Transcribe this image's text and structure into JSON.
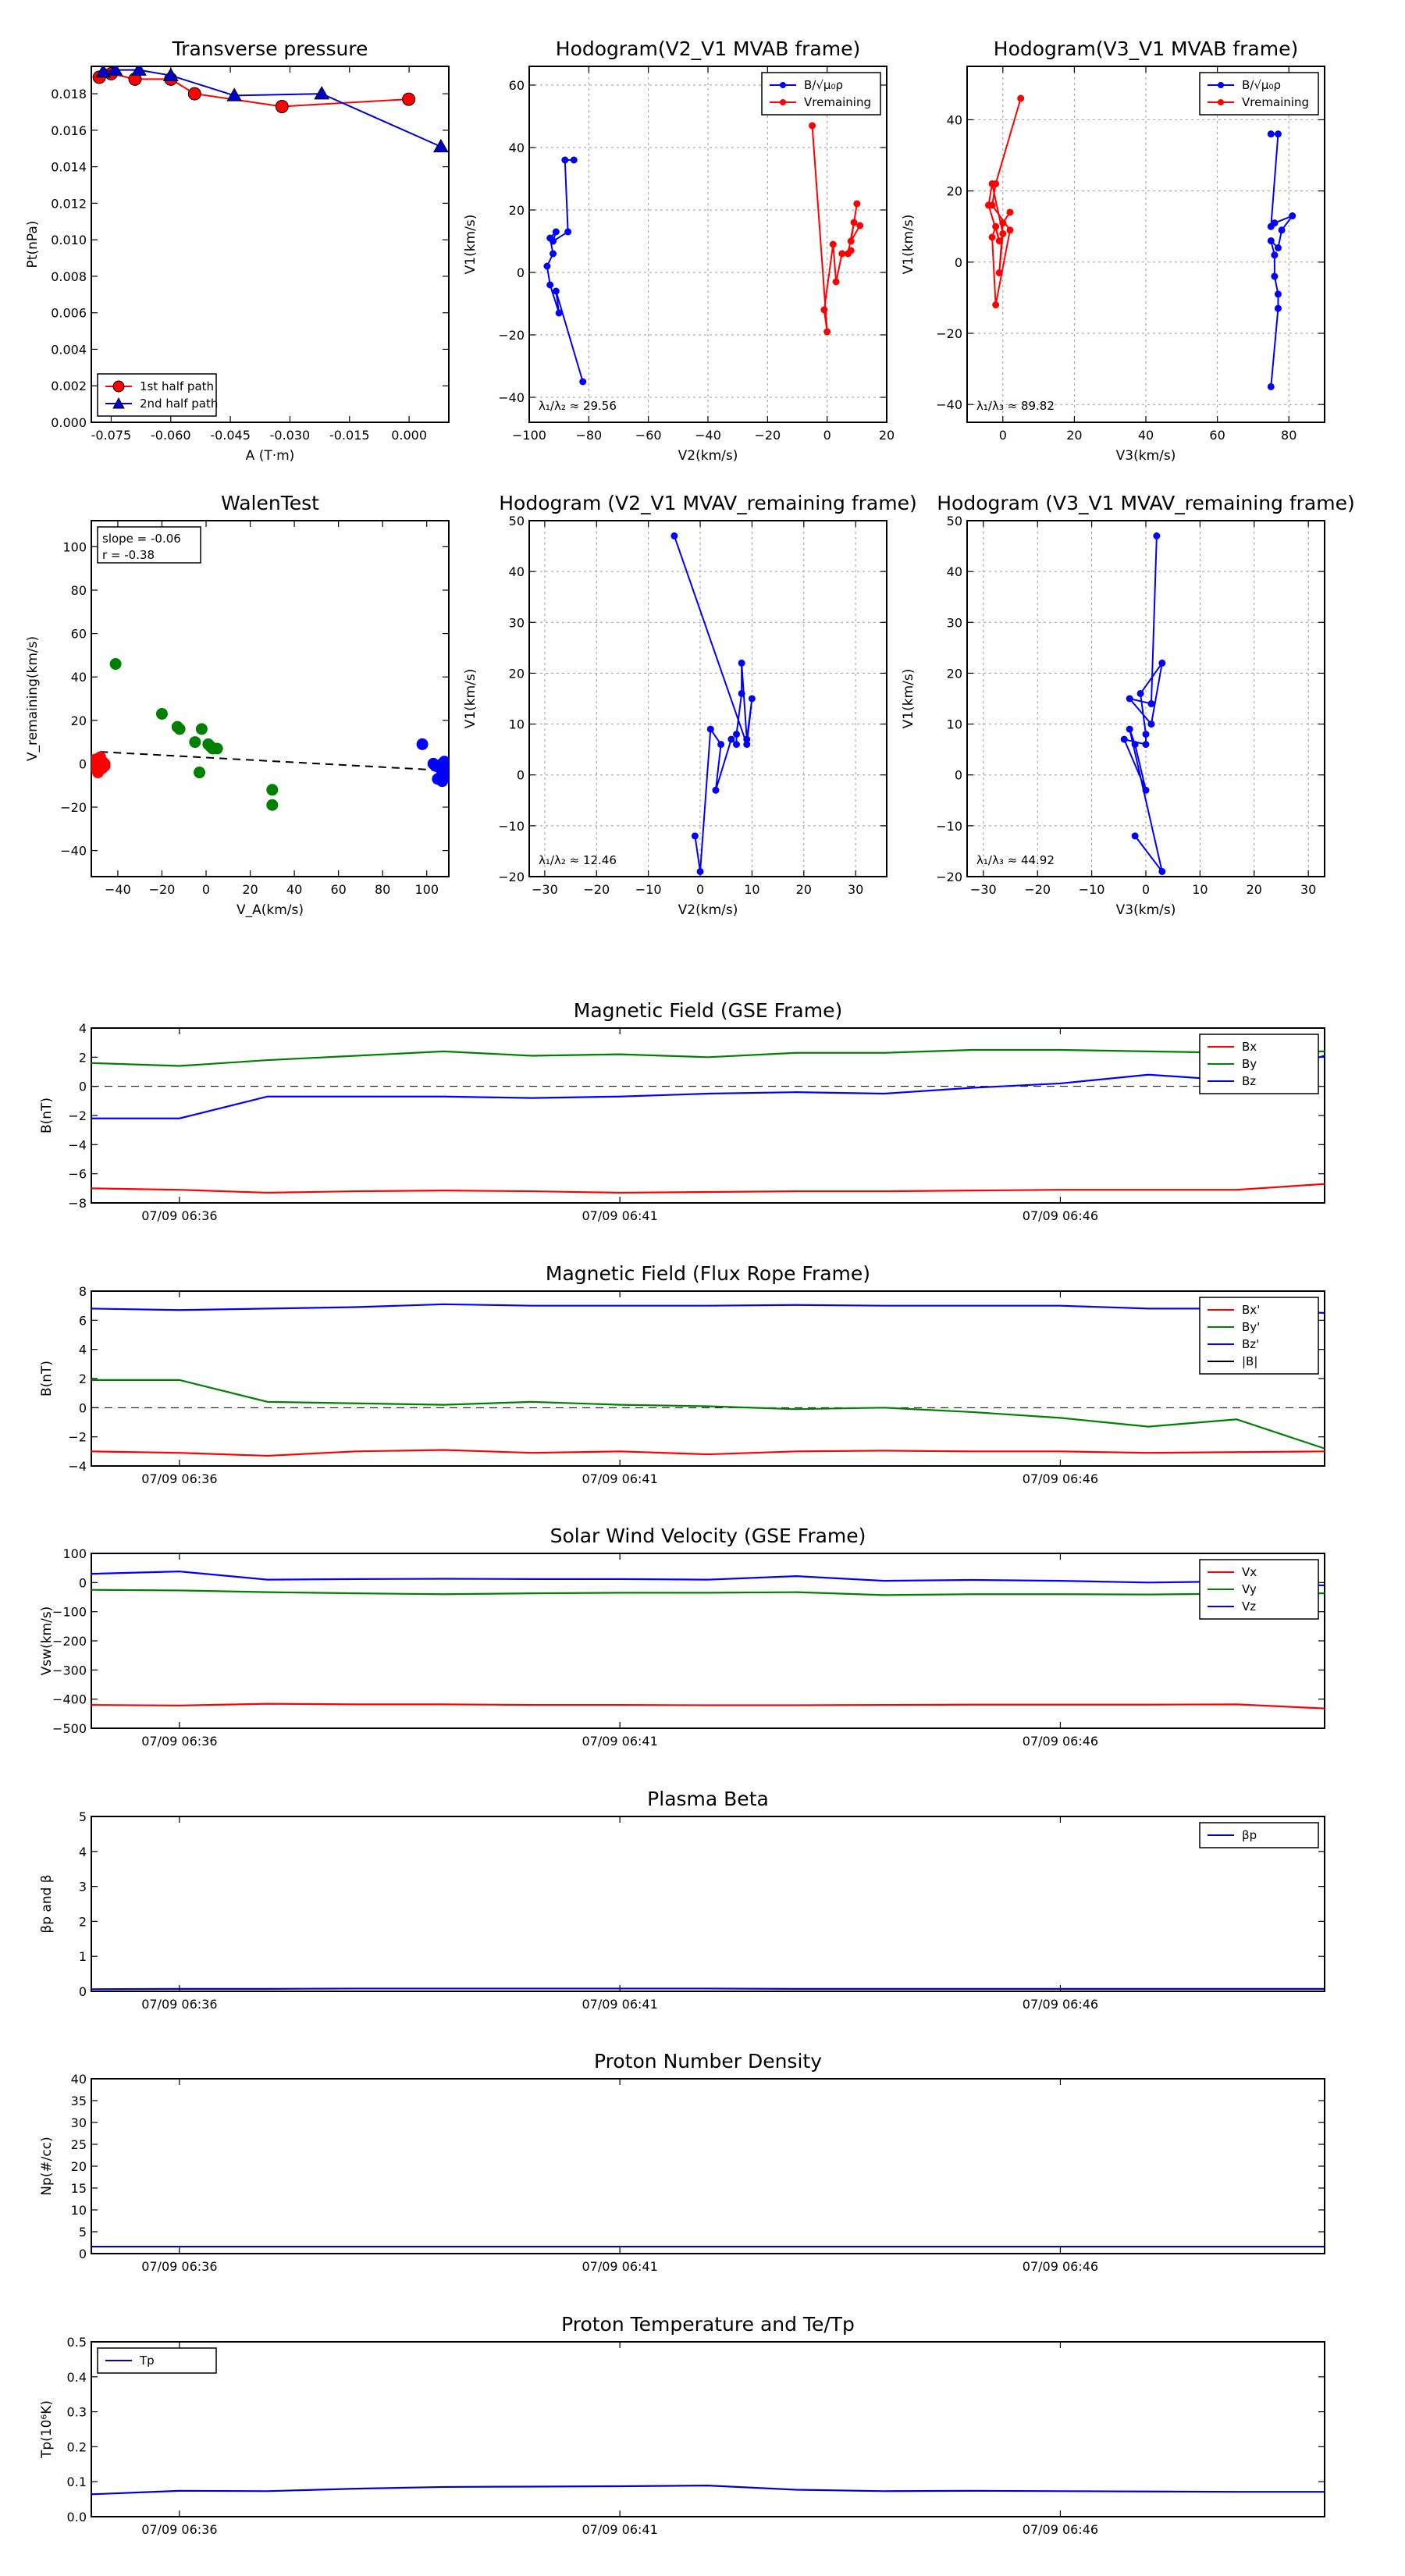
{
  "figure": {
    "background": "#ffffff"
  },
  "chart_data": [
    {
      "id": "tp",
      "type": "line",
      "title": "Transverse pressure",
      "xlabel": "A (T·m)",
      "ylabel": "Pt(nPa)",
      "xlim": [
        -0.08,
        0.01
      ],
      "ylim": [
        0.0,
        0.0195
      ],
      "xticks": [
        -0.075,
        -0.06,
        -0.045,
        -0.03,
        -0.015,
        0.0
      ],
      "xtick_labels": [
        "-0.075",
        "-0.060",
        "-0.045",
        "-0.030",
        "-0.015",
        "0.000"
      ],
      "yticks": [
        0.0,
        0.002,
        0.004,
        0.006,
        0.008,
        0.01,
        0.012,
        0.014,
        0.016,
        0.018
      ],
      "ytick_labels": [
        "0.000",
        "0.002",
        "0.004",
        "0.006",
        "0.008",
        "0.010",
        "0.012",
        "0.014",
        "0.016",
        "0.018"
      ],
      "grid": false,
      "legend": "lower-left",
      "series": [
        {
          "name": "1st half path",
          "color": "#ff0000",
          "marker": "circle",
          "x": [
            -0.0001,
            -0.032,
            -0.054,
            -0.06,
            -0.069,
            -0.075,
            -0.078
          ],
          "y": [
            0.0177,
            0.0173,
            0.018,
            0.0188,
            0.0188,
            0.0191,
            0.0189
          ]
        },
        {
          "name": "2nd half path",
          "color": "#0000cc",
          "marker": "triangle",
          "x": [
            -0.077,
            -0.074,
            -0.068,
            -0.06,
            -0.044,
            -0.022,
            0.008
          ],
          "y": [
            0.0192,
            0.0193,
            0.0193,
            0.019,
            0.0179,
            0.018,
            0.0151
          ]
        }
      ]
    },
    {
      "id": "h1",
      "type": "line",
      "title": "Hodogram(V2_V1 MVAB frame)",
      "xlabel": "V2(km/s)",
      "ylabel": "V1(km/s)",
      "xlim": [
        -100,
        20
      ],
      "ylim": [
        -48,
        66
      ],
      "xticks": [
        -100,
        -80,
        -60,
        -40,
        -20,
        0,
        20
      ],
      "yticks": [
        -40,
        -20,
        0,
        20,
        40,
        60
      ],
      "grid": true,
      "legend": "top-right",
      "annotation": "λ₁/λ₂ ≈ 29.56",
      "series": [
        {
          "name": "B/√μ₀ρ",
          "color": "#0000ff",
          "marker": "dot",
          "x": [
            -82,
            -91,
            -90,
            -93,
            -94,
            -92,
            -93,
            -91,
            -92,
            -87,
            -88,
            -85
          ],
          "y": [
            -35,
            -6,
            -13,
            -4,
            2,
            6,
            11,
            13,
            10,
            13,
            36,
            36
          ]
        },
        {
          "name": "Vremaining",
          "color": "#ff0000",
          "marker": "dot",
          "x": [
            -5,
            0,
            -1,
            2,
            3,
            5,
            8,
            7,
            9,
            10,
            8,
            11
          ],
          "y": [
            47,
            -19,
            -12,
            9,
            -3,
            6,
            7,
            6,
            16,
            22,
            10,
            15
          ]
        }
      ]
    },
    {
      "id": "h2",
      "type": "line",
      "title": "Hodogram(V3_V1 MVAB frame)",
      "xlabel": "V3(km/s)",
      "ylabel": "V1(km/s)",
      "xlim": [
        -10,
        90
      ],
      "ylim": [
        -45,
        55
      ],
      "xticks": [
        0,
        20,
        40,
        60,
        80
      ],
      "yticks": [
        -40,
        -20,
        0,
        20,
        40
      ],
      "grid": true,
      "legend": "top-right",
      "annotation": "λ₁/λ₃ ≈ 89.82",
      "series": [
        {
          "name": "B/√μ₀ρ",
          "color": "#0000ff",
          "marker": "dot",
          "x": [
            75,
            77,
            77,
            76,
            76,
            75,
            77,
            78,
            81,
            76,
            75,
            77,
            75
          ],
          "y": [
            -35,
            -13,
            -9,
            -4,
            2,
            6,
            4,
            9,
            13,
            11,
            10,
            36,
            36
          ]
        },
        {
          "name": "Vremaining",
          "color": "#ff0000",
          "marker": "dot",
          "x": [
            5,
            -2,
            -3,
            2,
            -2,
            -3,
            -2,
            -1,
            -4,
            -3,
            0,
            -1,
            0,
            2
          ],
          "y": [
            46,
            22,
            16,
            9,
            -12,
            7,
            10,
            6,
            16,
            22,
            8,
            -3,
            11,
            14
          ]
        }
      ]
    },
    {
      "id": "walen",
      "type": "scatter",
      "title": "WalenTest",
      "xlabel": "V_A(km/s)",
      "ylabel": "V_remaining(km/s)",
      "xlim": [
        -52,
        110
      ],
      "ylim": [
        -52,
        112
      ],
      "xticks": [
        -40,
        -20,
        0,
        20,
        40,
        60,
        80,
        100
      ],
      "yticks": [
        -40,
        -20,
        0,
        20,
        40,
        60,
        80,
        100
      ],
      "grid": false,
      "annotation_lines": [
        "slope = -0.06",
        "r = -0.38"
      ],
      "fit_line": {
        "x": [
          -48,
          110
        ],
        "y": [
          5.5,
          -3.2
        ]
      },
      "series": [
        {
          "name": "",
          "color": "#ff0000",
          "x": [
            -50,
            -49,
            -48,
            -47,
            -46,
            -48,
            -50,
            -47,
            -49,
            -46,
            -48
          ],
          "y": [
            2,
            1,
            -1,
            -2,
            0,
            3,
            -2,
            1,
            -4,
            -1,
            2
          ]
        },
        {
          "name": "",
          "color": "#008000",
          "x": [
            -41,
            -20,
            -13,
            -12,
            -5,
            -3,
            -2,
            1,
            3,
            5,
            2,
            30,
            30
          ],
          "y": [
            46,
            23,
            17,
            16,
            10,
            -4,
            16,
            9,
            7,
            7,
            8,
            -12,
            -19
          ]
        },
        {
          "name": "",
          "color": "#0000ff",
          "x": [
            98,
            104,
            106,
            107,
            108,
            109,
            105,
            107,
            110,
            103,
            108,
            109
          ],
          "y": [
            9,
            -1,
            -2,
            0,
            -3,
            -5,
            -7,
            -8,
            -2,
            0,
            1,
            -6
          ]
        }
      ]
    },
    {
      "id": "h3",
      "type": "line",
      "title": "Hodogram (V2_V1 MVAV_remaining frame)",
      "xlabel": "V2(km/s)",
      "ylabel": "V1(km/s)",
      "xlim": [
        -33,
        36
      ],
      "ylim": [
        -20,
        50
      ],
      "xticks": [
        -30,
        -20,
        -10,
        0,
        10,
        20,
        30
      ],
      "yticks": [
        -20,
        -10,
        0,
        10,
        20,
        30,
        40,
        50
      ],
      "grid": true,
      "annotation": "λ₁/λ₂ ≈ 12.46",
      "series": [
        {
          "name": "",
          "color": "#0000ff",
          "marker": "dot",
          "x": [
            -1,
            0,
            2,
            4,
            3,
            6,
            7,
            7,
            8,
            8,
            9,
            10,
            9,
            -5
          ],
          "y": [
            -12,
            -19,
            9,
            6,
            -3,
            7,
            6,
            8,
            16,
            22,
            7,
            15,
            6,
            47
          ]
        }
      ]
    },
    {
      "id": "h4",
      "type": "line",
      "title": "Hodogram (V3_V1 MVAV_remaining frame)",
      "xlabel": "V3(km/s)",
      "ylabel": "V1(km/s)",
      "xlim": [
        -33,
        33
      ],
      "ylim": [
        -20,
        50
      ],
      "xticks": [
        -30,
        -20,
        -10,
        0,
        10,
        20,
        30
      ],
      "yticks": [
        -20,
        -10,
        0,
        10,
        20,
        30,
        40,
        50
      ],
      "grid": true,
      "annotation": "λ₁/λ₃ ≈ 44.92",
      "series": [
        {
          "name": "",
          "color": "#0000ff",
          "marker": "dot",
          "x": [
            -2,
            3,
            -3,
            -2,
            0,
            -4,
            0,
            0,
            -1,
            3,
            1,
            -3,
            1,
            2
          ],
          "y": [
            -12,
            -19,
            9,
            6,
            -3,
            7,
            6,
            8,
            16,
            22,
            10,
            15,
            14,
            47
          ]
        }
      ]
    },
    {
      "id": "ts_b_gse",
      "type": "line",
      "title": "Magnetic Field (GSE Frame)",
      "ylabel": "B(nT)",
      "xlim": [
        0,
        14
      ],
      "ylim": [
        -8,
        4
      ],
      "yticks": [
        -8,
        -6,
        -4,
        -2,
        0,
        2,
        4
      ],
      "xtick_positions": [
        1,
        6,
        11
      ],
      "xtick_labels": [
        "07/09 06:36",
        "07/09 06:41",
        "07/09 06:46"
      ],
      "zero_line": true,
      "legend": "top-right",
      "x": [
        0,
        1,
        2,
        3,
        4,
        5,
        6,
        7,
        8,
        9,
        10,
        11,
        12,
        13,
        14
      ],
      "series": [
        {
          "name": "Bx",
          "color": "#ff0000",
          "values": [
            -7.0,
            -7.1,
            -7.3,
            -7.2,
            -7.15,
            -7.2,
            -7.3,
            -7.25,
            -7.2,
            -7.2,
            -7.15,
            -7.1,
            -7.1,
            -7.1,
            -6.7
          ]
        },
        {
          "name": "By",
          "color": "#008000",
          "values": [
            1.6,
            1.4,
            1.8,
            2.1,
            2.4,
            2.1,
            2.2,
            2.0,
            2.3,
            2.3,
            2.5,
            2.5,
            2.4,
            2.3,
            2.4
          ]
        },
        {
          "name": "Bz",
          "color": "#0000ff",
          "values": [
            -2.2,
            -2.2,
            -0.7,
            -0.7,
            -0.7,
            -0.8,
            -0.7,
            -0.5,
            -0.4,
            -0.5,
            -0.1,
            0.2,
            0.8,
            0.4,
            2.1
          ]
        }
      ]
    },
    {
      "id": "ts_b_fr",
      "type": "line",
      "title": "Magnetic Field (Flux Rope Frame)",
      "ylabel": "B(nT)",
      "xlim": [
        0,
        14
      ],
      "ylim": [
        -4,
        8
      ],
      "yticks": [
        -4,
        -2,
        0,
        2,
        4,
        6,
        8
      ],
      "xtick_positions": [
        1,
        6,
        11
      ],
      "xtick_labels": [
        "07/09 06:36",
        "07/09 06:41",
        "07/09 06:46"
      ],
      "zero_line": true,
      "legend": "top-right",
      "x": [
        0,
        1,
        2,
        3,
        4,
        5,
        6,
        7,
        8,
        9,
        10,
        11,
        12,
        13,
        14
      ],
      "series": [
        {
          "name": "Bx'",
          "color": "#ff0000",
          "values": [
            -3.0,
            -3.1,
            -3.3,
            -3.0,
            -2.9,
            -3.1,
            -3.0,
            -3.2,
            -3.0,
            -2.95,
            -3.0,
            -3.0,
            -3.1,
            -3.05,
            -3.0
          ]
        },
        {
          "name": "By'",
          "color": "#008000",
          "values": [
            1.9,
            1.9,
            0.4,
            0.3,
            0.2,
            0.4,
            0.2,
            0.1,
            -0.1,
            0.0,
            -0.3,
            -0.7,
            -1.3,
            -0.8,
            -2.8
          ]
        },
        {
          "name": "Bz'",
          "color": "#0000ff",
          "values": [
            6.8,
            6.7,
            6.8,
            6.9,
            7.1,
            7.0,
            7.0,
            7.0,
            7.05,
            7.0,
            7.0,
            7.0,
            6.8,
            6.8,
            6.5
          ]
        },
        {
          "name": "|B|",
          "color": "#000000",
          "values": []
        }
      ]
    },
    {
      "id": "ts_v",
      "type": "line",
      "title": "Solar Wind Velocity (GSE Frame)",
      "ylabel": "Vsw(km/s)",
      "xlim": [
        0,
        14
      ],
      "ylim": [
        -500,
        100
      ],
      "yticks": [
        -500,
        -400,
        -300,
        -200,
        -100,
        0,
        100
      ],
      "ytick_labels": [
        "−500",
        "−400",
        "−300",
        "−200",
        "−100",
        "0",
        "100"
      ],
      "xtick_positions": [
        1,
        6,
        11
      ],
      "xtick_labels": [
        "07/09 06:36",
        "07/09 06:41",
        "07/09 06:46"
      ],
      "legend": "top-right",
      "x": [
        0,
        1,
        2,
        3,
        4,
        5,
        6,
        7,
        8,
        9,
        10,
        11,
        12,
        13,
        14
      ],
      "series": [
        {
          "name": "Vx",
          "color": "#ff0000",
          "values": [
            -420,
            -422,
            -416,
            -418,
            -418,
            -420,
            -420,
            -421,
            -421,
            -420,
            -419,
            -419,
            -419,
            -418,
            -432
          ]
        },
        {
          "name": "Vy",
          "color": "#008000",
          "values": [
            -25,
            -27,
            -33,
            -37,
            -40,
            -37,
            -35,
            -35,
            -33,
            -43,
            -40,
            -40,
            -41,
            -38,
            -37
          ]
        },
        {
          "name": "Vz",
          "color": "#0000ff",
          "values": [
            30,
            38,
            10,
            12,
            13,
            12,
            12,
            10,
            22,
            6,
            9,
            6,
            0,
            4,
            -10
          ]
        }
      ]
    },
    {
      "id": "ts_beta",
      "type": "line",
      "title": "Plasma Beta",
      "ylabel": "βp and β",
      "xlim": [
        0,
        14
      ],
      "ylim": [
        0,
        5
      ],
      "yticks": [
        0,
        1,
        2,
        3,
        4,
        5
      ],
      "xtick_positions": [
        1,
        6,
        11
      ],
      "xtick_labels": [
        "07/09 06:36",
        "07/09 06:41",
        "07/09 06:46"
      ],
      "legend": "top-right",
      "x": [
        0,
        1,
        2,
        3,
        4,
        5,
        6,
        7,
        8,
        9,
        10,
        11,
        12,
        13,
        14
      ],
      "series": [
        {
          "name": "βp",
          "color": "#0000cc",
          "values": [
            0.06,
            0.07,
            0.07,
            0.08,
            0.08,
            0.08,
            0.08,
            0.08,
            0.07,
            0.07,
            0.07,
            0.07,
            0.07,
            0.07,
            0.07
          ]
        }
      ]
    },
    {
      "id": "ts_np",
      "type": "line",
      "title": "Proton Number Density",
      "ylabel": "Np(#/cc)",
      "xlim": [
        0,
        14
      ],
      "ylim": [
        0,
        40
      ],
      "yticks": [
        0,
        5,
        10,
        15,
        20,
        25,
        30,
        35,
        40
      ],
      "xtick_positions": [
        1,
        6,
        11
      ],
      "xtick_labels": [
        "07/09 06:36",
        "07/09 06:41",
        "07/09 06:46"
      ],
      "x": [
        0,
        1,
        2,
        3,
        4,
        5,
        6,
        7,
        8,
        9,
        10,
        11,
        12,
        13,
        14
      ],
      "series": [
        {
          "name": "",
          "color": "#0000cc",
          "values": [
            1.6,
            1.6,
            1.6,
            1.6,
            1.6,
            1.6,
            1.6,
            1.6,
            1.6,
            1.6,
            1.6,
            1.6,
            1.6,
            1.6,
            1.6
          ]
        }
      ]
    },
    {
      "id": "ts_tp",
      "type": "line",
      "title": "Proton Temperature and Te/Tp",
      "ylabel": "Tp(10⁶K)",
      "xlim": [
        0,
        14
      ],
      "ylim": [
        0,
        0.5
      ],
      "yticks": [
        0.0,
        0.1,
        0.2,
        0.3,
        0.4,
        0.5
      ],
      "ytick_labels": [
        "0.0",
        "0.1",
        "0.2",
        "0.3",
        "0.4",
        "0.5"
      ],
      "xtick_positions": [
        1,
        6,
        11
      ],
      "xtick_labels": [
        "07/09 06:36",
        "07/09 06:41",
        "07/09 06:46"
      ],
      "legend": "top-left",
      "x": [
        0,
        1,
        2,
        3,
        4,
        5,
        6,
        7,
        8,
        9,
        10,
        11,
        12,
        13,
        14
      ],
      "series": [
        {
          "name": "Tp",
          "color": "#0000cc",
          "values": [
            0.064,
            0.074,
            0.073,
            0.08,
            0.085,
            0.086,
            0.087,
            0.089,
            0.077,
            0.073,
            0.074,
            0.073,
            0.072,
            0.071,
            0.071
          ]
        }
      ]
    }
  ]
}
